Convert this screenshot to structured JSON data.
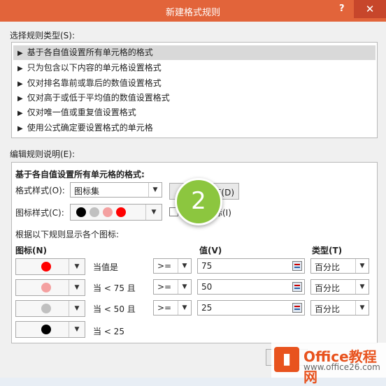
{
  "window": {
    "title": "新建格式规则",
    "help": "?",
    "close": "✕"
  },
  "rule_type": {
    "label": "选择规则类型(S):",
    "items": [
      {
        "label": "基于各自值设置所有单元格的格式",
        "selected": true
      },
      {
        "label": "只为包含以下内容的单元格设置格式"
      },
      {
        "label": "仅对排名靠前或靠后的数值设置格式"
      },
      {
        "label": "仅对高于或低于平均值的数值设置格式"
      },
      {
        "label": "仅对唯一值或重复值设置格式"
      },
      {
        "label": "使用公式确定要设置格式的单元格"
      }
    ]
  },
  "edit": {
    "label": "编辑规则说明(E):",
    "heading": "基于各自值设置所有单元格的格式:",
    "format_style_label": "格式样式(O):",
    "format_style_value": "图标集",
    "reverse_button": "序(D)",
    "icon_style_label": "图标样式(C):",
    "show_icon_only_fragment": "标(I)",
    "rules_caption": "根据以下规则显示各个图标:",
    "col_icon": "图标(N)",
    "col_value": "值(V)",
    "col_type": "类型(T)",
    "icon_style_colors": [
      "#000000",
      "#c0c0c0",
      "#f4a0a0",
      "#ff0000"
    ],
    "rows": [
      {
        "icon_color": "#ff0000",
        "condition": "当值是",
        "op": ">=",
        "value": "75",
        "type": "百分比"
      },
      {
        "icon_color": "#f4a0a0",
        "condition": "当 < 75 且",
        "op": ">=",
        "value": "50",
        "type": "百分比"
      },
      {
        "icon_color": "#c0c0c0",
        "condition": "当 < 50 且",
        "op": ">=",
        "value": "25",
        "type": "百分比"
      },
      {
        "icon_color": "#000000",
        "condition": "当 < 25"
      }
    ]
  },
  "step_badge": "2",
  "watermark": {
    "name": "Office教程网",
    "url": "www.office26.com"
  },
  "colors": {
    "titlebar": "#e2643a",
    "badge": "#8cc63f"
  }
}
